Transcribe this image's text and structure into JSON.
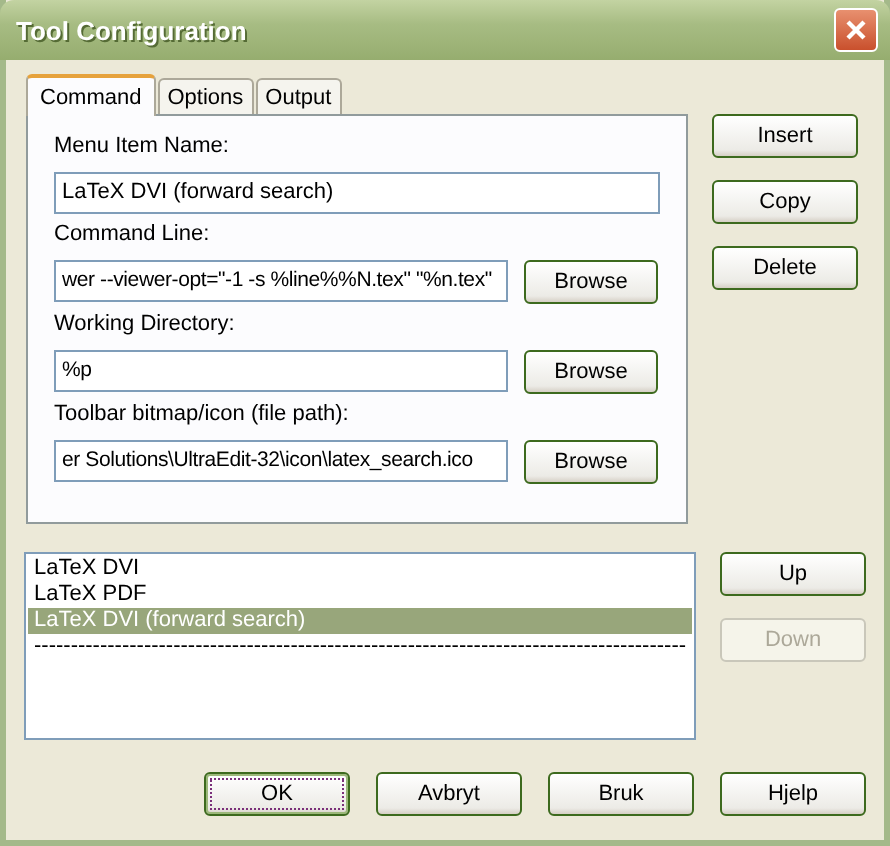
{
  "window": {
    "title": "Tool Configuration"
  },
  "tabs": [
    {
      "label": "Command",
      "selected": true
    },
    {
      "label": "Options",
      "selected": false
    },
    {
      "label": "Output",
      "selected": false
    }
  ],
  "fields": [
    {
      "label": "Menu Item Name:",
      "value": "LaTeX DVI (forward search)"
    },
    {
      "label": "Command Line:",
      "value": "wer --viewer-opt=\"-1 -s %line%%N.tex\" \"%n.tex\"",
      "browse": "Browse"
    },
    {
      "label": "Working Directory:",
      "value": "%p",
      "browse": "Browse"
    },
    {
      "label": "Toolbar bitmap/icon (file path):",
      "value": "er Solutions\\UltraEdit-32\\icon\\latex_search.ico",
      "browse": "Browse"
    }
  ],
  "side_buttons": [
    {
      "label": "Insert",
      "disabled": false
    },
    {
      "label": "Copy",
      "disabled": false
    },
    {
      "label": "Delete",
      "disabled": false
    }
  ],
  "tools_list": [
    {
      "label": "LaTeX DVI",
      "selected": false
    },
    {
      "label": "LaTeX PDF",
      "selected": false
    },
    {
      "label": "LaTeX DVI (forward search)",
      "selected": true
    },
    {
      "label": "-----------------------------------------------------------------------------------------",
      "selected": false
    }
  ],
  "order_buttons": [
    {
      "label": "Up",
      "disabled": false
    },
    {
      "label": "Down",
      "disabled": true
    }
  ],
  "footer_buttons": [
    {
      "label": "OK",
      "default": true
    },
    {
      "label": "Avbryt",
      "default": false
    },
    {
      "label": "Bruk",
      "default": false
    },
    {
      "label": "Hjelp",
      "default": false
    }
  ]
}
